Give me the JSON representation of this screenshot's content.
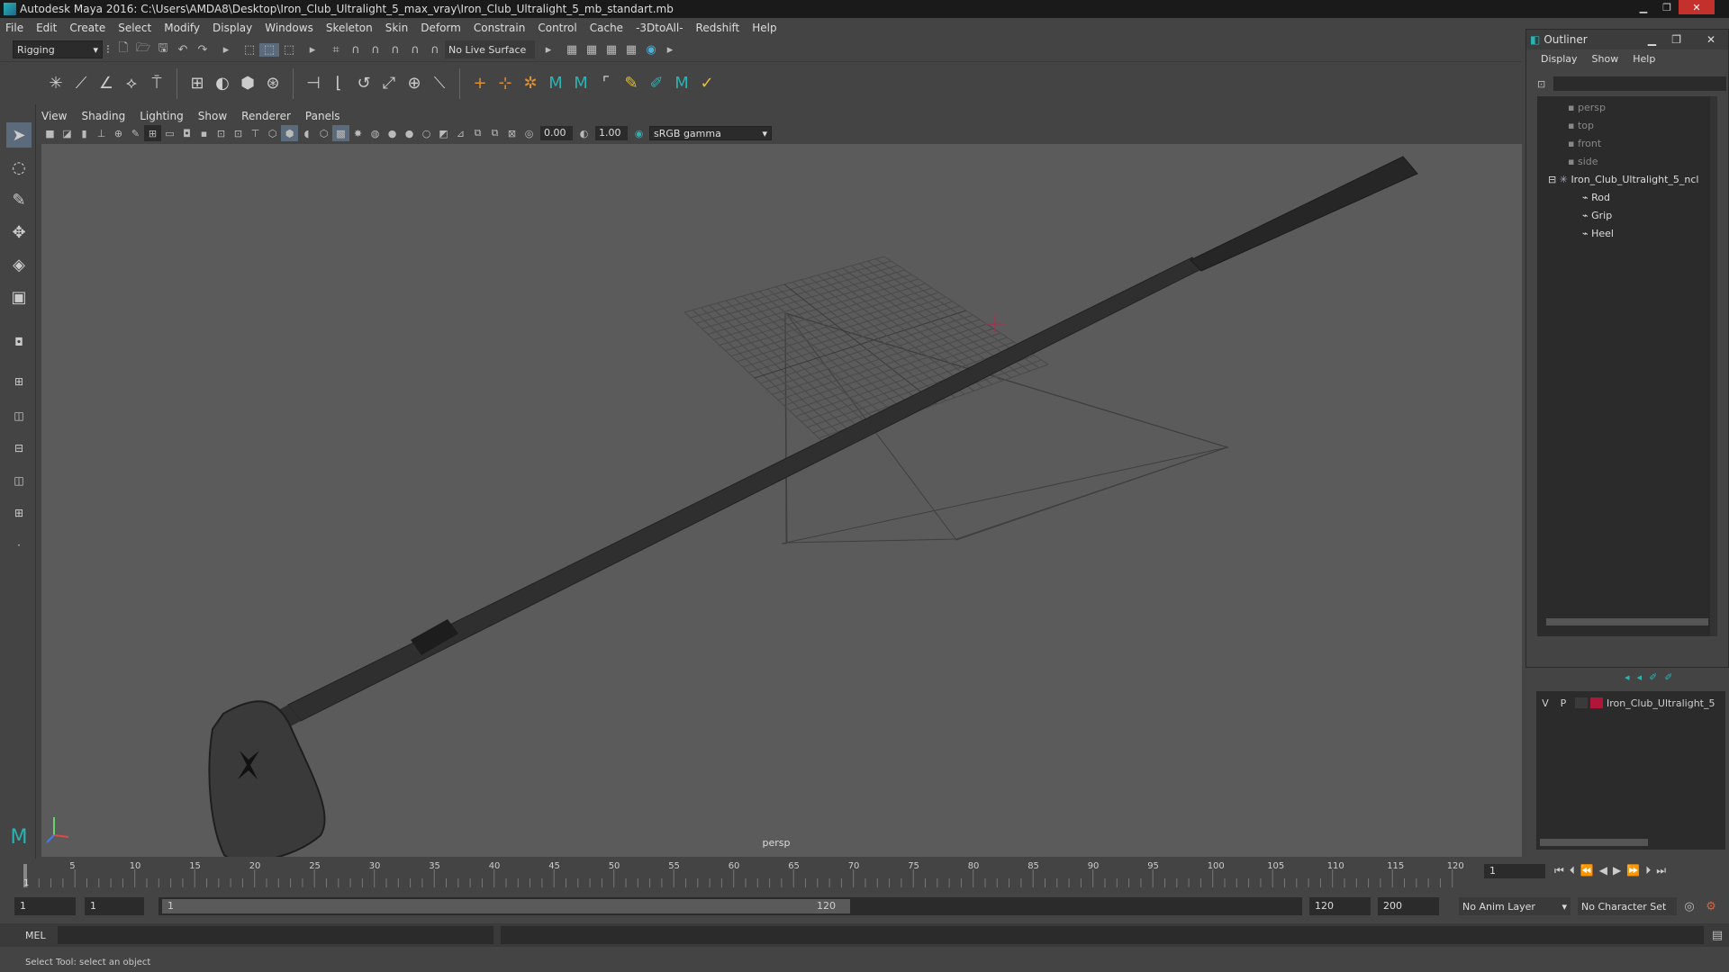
{
  "window": {
    "title": "Autodesk Maya 2016: C:\\Users\\AMDA8\\Desktop\\Iron_Club_Ultralight_5_max_vray\\Iron_Club_Ultralight_5_mb_standart.mb"
  },
  "menubar": [
    "File",
    "Edit",
    "Create",
    "Select",
    "Modify",
    "Display",
    "Windows",
    "Skeleton",
    "Skin",
    "Deform",
    "Constrain",
    "Control",
    "Cache",
    "-3DtoAll-",
    "Redshift",
    "Help"
  ],
  "statusline": {
    "mode": "Rigging",
    "live_surface": "No Live Surface"
  },
  "viewport": {
    "menu": [
      "View",
      "Shading",
      "Lighting",
      "Show",
      "Renderer",
      "Panels"
    ],
    "exposure": "0.00",
    "gamma": "1.00",
    "color_space": "sRGB gamma",
    "camera_label": "persp"
  },
  "outliner": {
    "title": "Outliner",
    "menu": [
      "Display",
      "Show",
      "Help"
    ],
    "items": [
      {
        "label": "persp",
        "type": "camera"
      },
      {
        "label": "top",
        "type": "camera"
      },
      {
        "label": "front",
        "type": "camera"
      },
      {
        "label": "side",
        "type": "camera"
      },
      {
        "label": "Iron_Club_Ultralight_5_ncl",
        "type": "group"
      },
      {
        "label": "Rod",
        "type": "mesh"
      },
      {
        "label": "Grip",
        "type": "mesh"
      },
      {
        "label": "Heel",
        "type": "mesh"
      }
    ]
  },
  "layer_editor": {
    "v": "V",
    "p": "P",
    "layer_name": "Iron_Club_Ultralight_5",
    "layer_color": "#b0163a"
  },
  "timeline": {
    "ticks": [
      "5",
      "10",
      "15",
      "20",
      "25",
      "30",
      "35",
      "40",
      "45",
      "50",
      "55",
      "60",
      "65",
      "70",
      "75",
      "80",
      "85",
      "90",
      "95",
      "100",
      "105",
      "110",
      "115",
      "120"
    ],
    "first_tick": "1",
    "current_frame": "1"
  },
  "range": {
    "start": "1",
    "playback_start": "1",
    "slider_start": "1",
    "slider_end": "120",
    "playback_end": "120",
    "end": "200",
    "anim_layer": "No Anim Layer",
    "character_set": "No Character Set"
  },
  "cmdline": {
    "label": "MEL"
  },
  "helpline": {
    "text": "Select Tool: select an object"
  },
  "colors": {
    "accent": "#2ab3b3",
    "close": "#c4302b"
  }
}
